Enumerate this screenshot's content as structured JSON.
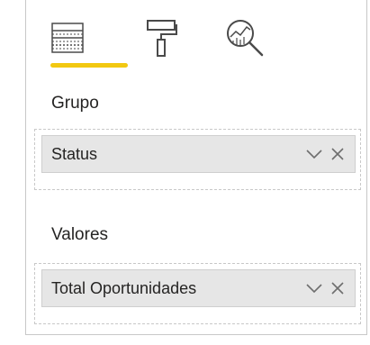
{
  "tabs": [
    {
      "id": "fields",
      "icon": "fields-icon",
      "active": true
    },
    {
      "id": "format",
      "icon": "paint-roller-icon",
      "active": false
    },
    {
      "id": "analytics",
      "icon": "analytics-magnifier-icon",
      "active": false
    }
  ],
  "accent_color": "#f2c811",
  "groups": {
    "grupo": {
      "label": "Grupo",
      "field": "Status"
    },
    "valores": {
      "label": "Valores",
      "field": "Total Oportunidades"
    }
  }
}
